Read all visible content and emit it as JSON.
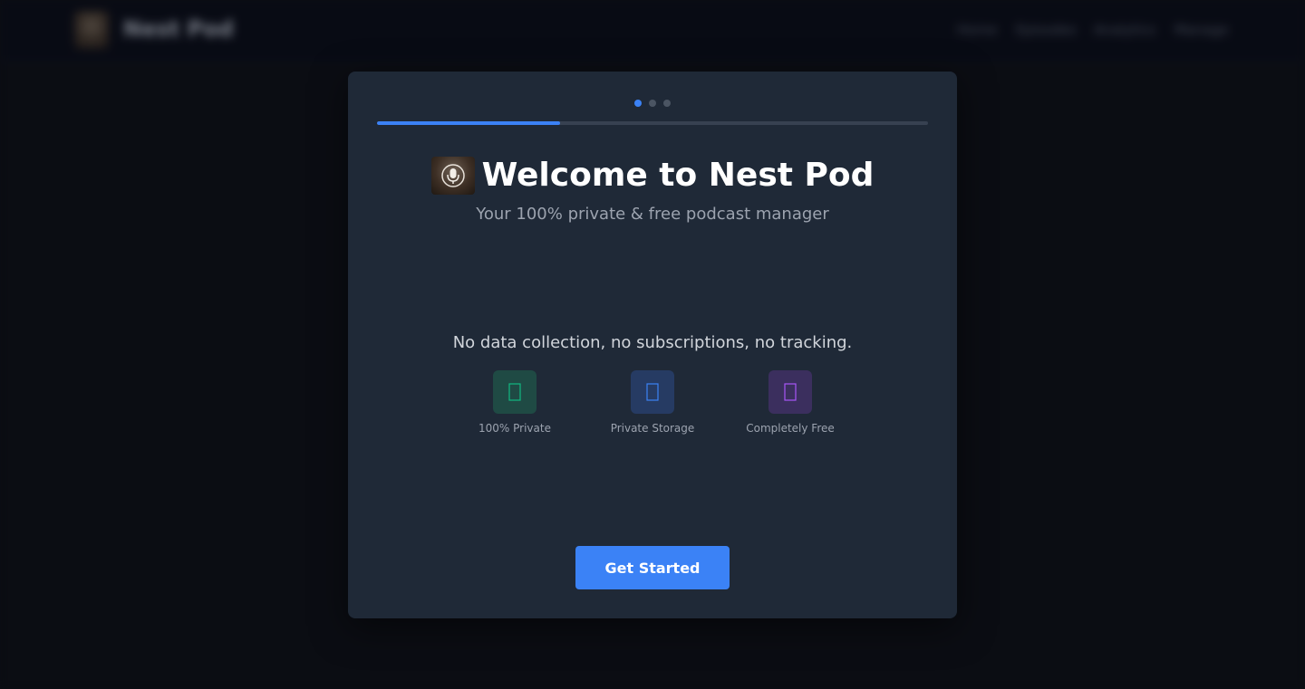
{
  "background": {
    "brand": "Nest Pod",
    "nav": [
      "Home",
      "Episodes",
      "Analytics",
      "Manage"
    ]
  },
  "onboarding": {
    "step_current": 1,
    "step_total": 3,
    "progress_fraction": 0.333,
    "title": "Welcome to Nest Pod",
    "subtitle": "Your 100% private & free podcast manager",
    "tagline": "No data collection, no subscriptions, no tracking.",
    "features": [
      {
        "label": "100% Private",
        "icon": "shield-icon",
        "color": "#10b981",
        "bg": "#1f4a44"
      },
      {
        "label": "Private Storage",
        "icon": "database-icon",
        "color": "#3b82f6",
        "bg": "#263b63"
      },
      {
        "label": "Completely Free",
        "icon": "gift-icon",
        "color": "#a855f7",
        "bg": "#3b2f5e"
      }
    ],
    "cta_label": "Get Started"
  },
  "colors": {
    "accent": "#3b82f6",
    "modal_bg": "#1f2937",
    "page_bg": "#0b0d13"
  }
}
